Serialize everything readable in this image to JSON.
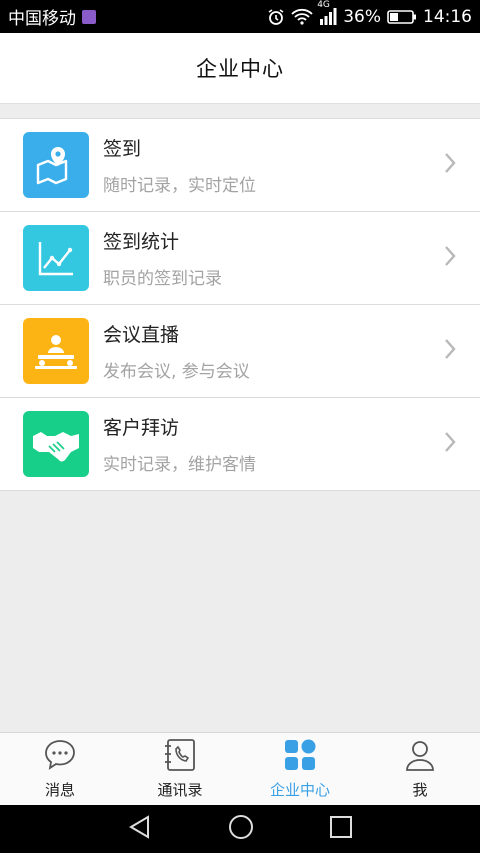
{
  "status_bar": {
    "carrier": "中国移动",
    "network": "4G",
    "battery": "36%",
    "time": "14:16"
  },
  "header": {
    "title": "企业中心"
  },
  "menu": [
    {
      "title": "签到",
      "subtitle": "随时记录，实时定位",
      "icon": "map-pin-icon",
      "color": "#3aaeea"
    },
    {
      "title": "签到统计",
      "subtitle": "职员的签到记录",
      "icon": "line-chart-icon",
      "color": "#33c8e0"
    },
    {
      "title": "会议直播",
      "subtitle": "发布会议, 参与会议",
      "icon": "meeting-icon",
      "color": "#fbb414"
    },
    {
      "title": "客户拜访",
      "subtitle": "实时记录，维护客情",
      "icon": "handshake-icon",
      "color": "#17cf88"
    }
  ],
  "tabs": [
    {
      "label": "消息",
      "icon": "chat-bubble-icon",
      "active": false
    },
    {
      "label": "通讯录",
      "icon": "contacts-book-icon",
      "active": false
    },
    {
      "label": "企业中心",
      "icon": "grid-icon",
      "active": true
    },
    {
      "label": "我",
      "icon": "person-icon",
      "active": false
    }
  ],
  "colors": {
    "accent": "#3aa0e6",
    "background": "#ededed"
  }
}
